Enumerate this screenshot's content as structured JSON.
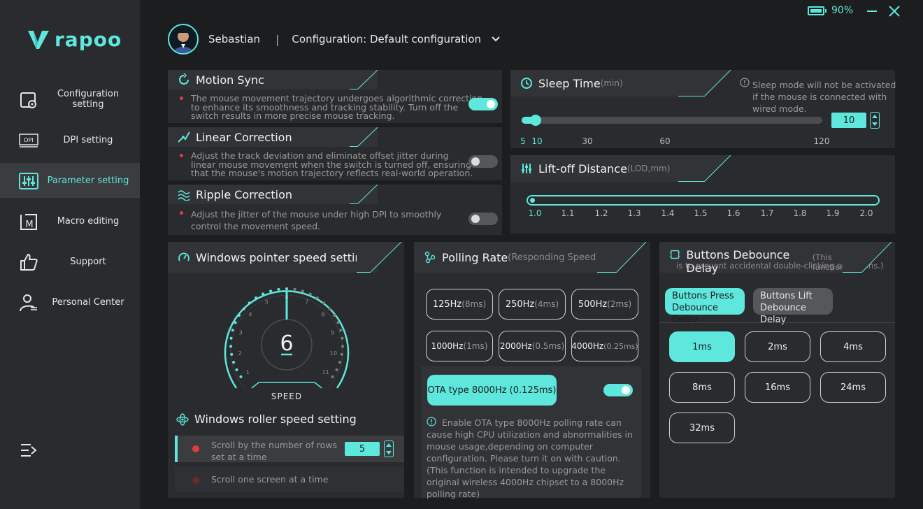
{
  "brand": "rapoo",
  "battery": {
    "level_text": "90%",
    "level": 0.9
  },
  "header": {
    "user": "Sebastian",
    "separator": "|",
    "config_label": "Configuration: Default configuration"
  },
  "sidebar": {
    "items": [
      {
        "label": "Configuration setting",
        "icon": "config-icon"
      },
      {
        "label": "DPI setting",
        "icon": "dpi-icon"
      },
      {
        "label": "Parameter setting",
        "icon": "parameter-icon"
      },
      {
        "label": "Macro editing",
        "icon": "macro-icon"
      },
      {
        "label": "Support",
        "icon": "thumbs-up-icon"
      },
      {
        "label": "Personal Center",
        "icon": "person-icon"
      }
    ],
    "active_index": 2
  },
  "motion_sync": {
    "title": "Motion Sync",
    "desc1": "The mouse movement trajectory undergoes algorithmic correction",
    "desc2": "to enhance its smoothness and tracking stability. Turn off the",
    "desc3": "switch results in more precise mouse tracking.",
    "enabled": true
  },
  "linear_correction": {
    "title": "Linear Correction",
    "desc1": "Adjust the track deviation and eliminate offset jitter during",
    "desc2": "linear mouse movement when the switch is turned off, ensuring",
    "desc3": "that the mouse's motion trajectory reflects real-world operation.",
    "enabled": false
  },
  "ripple_correction": {
    "title": "Ripple Correction",
    "desc1": "Adjust the jitter of the mouse under high DPI to smoothly",
    "desc2": "control the movement speed.",
    "enabled": false
  },
  "sleep_time": {
    "title": "Sleep Time",
    "unit": "(min)",
    "note1": "Sleep mode will not be activated",
    "note2": "if the mouse is connected with",
    "note3": "wired mode.",
    "value": "10",
    "ticks": [
      "5",
      "10",
      "30",
      "60",
      "120"
    ]
  },
  "lift_off": {
    "title": "Lift-off Distance",
    "unit": "(LOD,mm)",
    "ticks": [
      "1.0",
      "1.1",
      "1.2",
      "1.3",
      "1.4",
      "1.5",
      "1.6",
      "1.7",
      "1.8",
      "1.9",
      "2.0"
    ],
    "value": "1.0"
  },
  "pointer_speed": {
    "title": "Windows pointer speed setting",
    "value": "6",
    "label": "SPEED",
    "scale": [
      "1",
      "2",
      "3",
      "4",
      "5",
      "6",
      "7",
      "8",
      "9",
      "10",
      "11"
    ]
  },
  "roller_speed": {
    "title": "Windows roller speed setting",
    "opt1a": "Scroll by the number of rows",
    "opt1b": "set at a time",
    "rows": "5",
    "opt2": "Scroll one screen at a time"
  },
  "polling": {
    "title": "Polling Rate",
    "sub": "(Responding Speed)",
    "rates": [
      {
        "hz": "125Hz",
        "ms": "(8ms)"
      },
      {
        "hz": "250Hz",
        "ms": "(4ms)"
      },
      {
        "hz": "500Hz",
        "ms": "(2ms)"
      },
      {
        "hz": "1000Hz",
        "ms": "(1ms)"
      },
      {
        "hz": "2000Hz",
        "ms": "(0.5ms)"
      },
      {
        "hz": "4000Hz",
        "ms": "(0.25ms)"
      }
    ],
    "ota_label": "OTA type 8000Hz (0.125ms)",
    "ota_enabled": true,
    "ota_note": "Enable OTA type 8000Hz polling rate can cause high CPU utilization and abnormalities in mouse usage,depending on computer configuration. Please turn it on with caution.(This function is intended to upgrade the original wireless 4000Hz chipset to a 8000Hz polling rate)"
  },
  "debounce": {
    "title": "Buttons Debounce Delay",
    "sub1": "(This function",
    "sub2": "is to prevent accidental double-clicking of buttons.)",
    "tab_press_1": "Buttons Press",
    "tab_press_2": "Debounce Delay",
    "tab_lift_1": "Buttons Lift",
    "tab_lift_2": "Debounce Delay",
    "options": [
      "1ms",
      "2ms",
      "4ms",
      "8ms",
      "16ms",
      "24ms",
      "32ms"
    ],
    "selected": "1ms"
  },
  "colors": {
    "accent": "#5ee7dc",
    "panel": "#2a2b2e",
    "bg": "#1c1d1f"
  }
}
